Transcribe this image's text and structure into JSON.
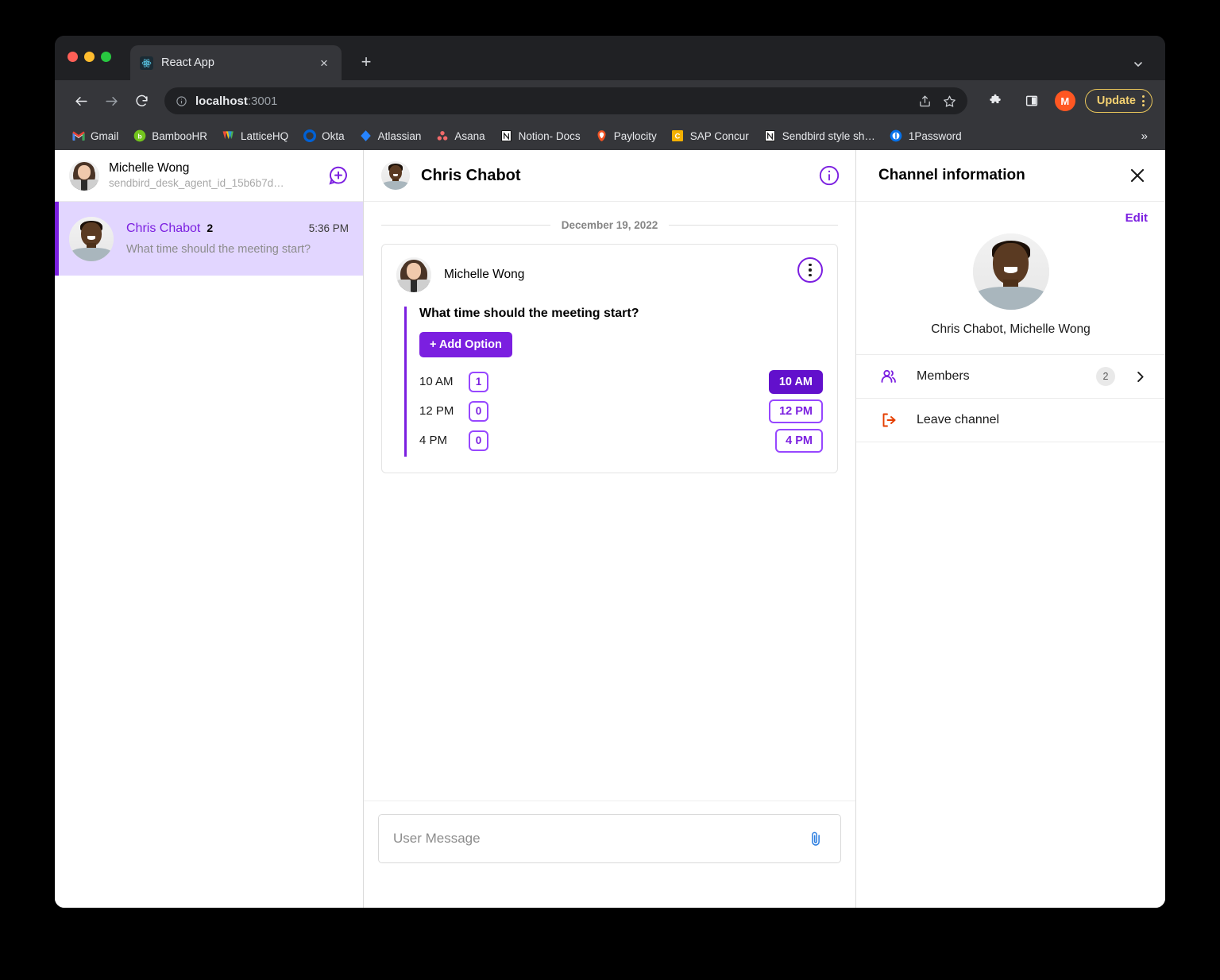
{
  "browser": {
    "tab": {
      "title": "React App",
      "favicon": "react-icon",
      "close_label": "×"
    },
    "new_tab_label": "+",
    "omnibox": {
      "url_host": "localhost",
      "url_port": ":3001",
      "info_icon": "site-info-icon"
    },
    "profile_initial": "M",
    "update_label": "Update",
    "bookmarks": [
      {
        "label": "Gmail",
        "icon": "gmail-icon"
      },
      {
        "label": "BambooHR",
        "icon": "bamboohr-icon"
      },
      {
        "label": "LatticeHQ",
        "icon": "latticehq-icon"
      },
      {
        "label": "Okta",
        "icon": "okta-icon"
      },
      {
        "label": "Atlassian",
        "icon": "atlassian-icon"
      },
      {
        "label": "Asana",
        "icon": "asana-icon"
      },
      {
        "label": "Notion- Docs",
        "icon": "notion-icon"
      },
      {
        "label": "Paylocity",
        "icon": "paylocity-icon"
      },
      {
        "label": "SAP Concur",
        "icon": "sap-concur-icon"
      },
      {
        "label": "Sendbird style sh…",
        "icon": "notion-icon"
      },
      {
        "label": "1Password",
        "icon": "onepassword-icon"
      }
    ],
    "bookmarks_overflow": "»"
  },
  "colors": {
    "primary": "#7b1fe0",
    "primary_dark": "#6210cc",
    "primary_light": "#9747ff",
    "selected_bg": "#e2d6ff",
    "danger": "#e53e00",
    "update_yellow": "#f4d171"
  },
  "sidebar": {
    "user": {
      "name": "Michelle Wong",
      "id": "sendbird_desk_agent_id_15b6b7d…",
      "avatar": "michelle-wong-avatar"
    },
    "create_channel_icon": "chat-plus-icon",
    "channels": [
      {
        "name": "Chris Chabot",
        "member_count": "2",
        "time": "5:36 PM",
        "preview": "What time should the meeting start?",
        "avatar": "chris-chabot-avatar",
        "selected": true
      }
    ]
  },
  "conversation": {
    "header": {
      "title": "Chris Chabot",
      "avatar": "chris-chabot-avatar",
      "info_icon": "info-circle-icon"
    },
    "date_separator": "December 19, 2022",
    "poll": {
      "author": "Michelle Wong",
      "author_avatar": "michelle-wong-avatar",
      "menu_icon": "more-vertical-icon",
      "question": "What time should the meeting start?",
      "add_option_label": "+ Add Option",
      "options": [
        {
          "label": "10 AM",
          "count": "1",
          "vote_label": "10 AM",
          "selected": true
        },
        {
          "label": "12 PM",
          "count": "0",
          "vote_label": "12 PM",
          "selected": false
        },
        {
          "label": "4 PM",
          "count": "0",
          "vote_label": "4 PM",
          "selected": false
        }
      ]
    },
    "composer": {
      "placeholder": "User Message",
      "value": "",
      "attach_icon": "paperclip-icon"
    }
  },
  "info_panel": {
    "title": "Channel information",
    "close_icon": "close-icon",
    "edit_label": "Edit",
    "avatar": "chris-chabot-avatar",
    "members_names": "Chris Chabot, Michelle Wong",
    "rows": [
      {
        "label": "Members",
        "icon": "members-icon",
        "badge": "2",
        "chevron": "chevron-right-icon"
      },
      {
        "label": "Leave channel",
        "icon": "leave-icon",
        "badge": "",
        "chevron": ""
      }
    ]
  }
}
